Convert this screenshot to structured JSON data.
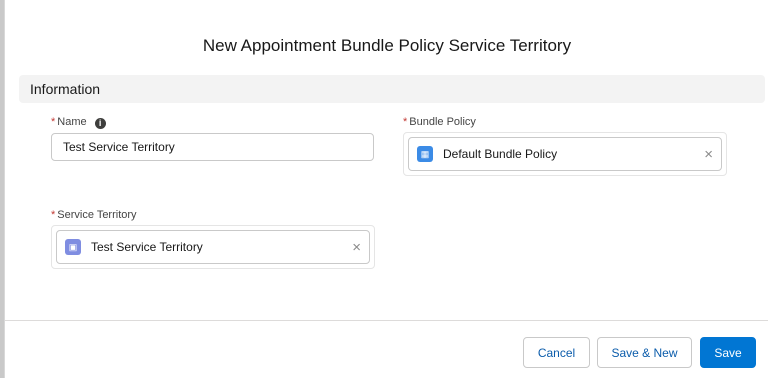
{
  "modal": {
    "title": "New Appointment Bundle Policy Service Territory",
    "section_title": "Information"
  },
  "fields": {
    "required_marker": "*",
    "name": {
      "label": "Name",
      "value": "Test Service Territory",
      "info_icon": "info-icon"
    },
    "bundle_policy": {
      "label": "Bundle Policy",
      "value": "Default Bundle Policy",
      "icon": "bundle-policy-icon"
    },
    "service_territory": {
      "label": "Service Territory",
      "value": "Test Service Territory",
      "icon": "service-territory-icon"
    },
    "remove_glyph": "×"
  },
  "footer": {
    "cancel_label": "Cancel",
    "save_new_label": "Save & New",
    "save_label": "Save"
  },
  "colors": {
    "brand": "#0176d3",
    "required": "#c23934",
    "section_bg": "#f3f3f3",
    "policy_icon": "#3b8be6",
    "territory_icon": "#7f8de1"
  }
}
